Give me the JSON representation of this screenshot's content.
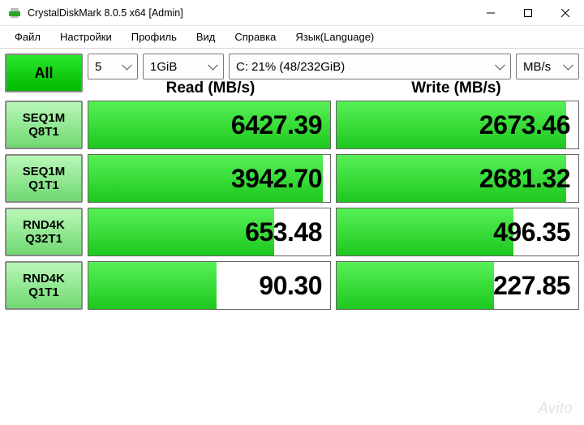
{
  "titlebar": {
    "title": "CrystalDiskMark 8.0.5 x64 [Admin]"
  },
  "menu": {
    "file": "Файл",
    "settings": "Настройки",
    "profile": "Профиль",
    "view": "Вид",
    "help": "Справка",
    "language": "Язык(Language)"
  },
  "controls": {
    "all": "All",
    "count": "5",
    "size": "1GiB",
    "drive": "C: 21% (48/232GiB)",
    "unit": "MB/s"
  },
  "headers": {
    "read": "Read (MB/s)",
    "write": "Write (MB/s)"
  },
  "tests": [
    {
      "line1": "SEQ1M",
      "line2": "Q8T1",
      "read": "6427.39",
      "read_pct": 100,
      "write": "2673.46",
      "write_pct": 95
    },
    {
      "line1": "SEQ1M",
      "line2": "Q1T1",
      "read": "3942.70",
      "read_pct": 97,
      "write": "2681.32",
      "write_pct": 95
    },
    {
      "line1": "RND4K",
      "line2": "Q32T1",
      "read": "653.48",
      "read_pct": 77,
      "write": "496.35",
      "write_pct": 73
    },
    {
      "line1": "RND4K",
      "line2": "Q1T1",
      "read": "90.30",
      "read_pct": 53,
      "write": "227.85",
      "write_pct": 65
    }
  ],
  "watermark": "Avito"
}
